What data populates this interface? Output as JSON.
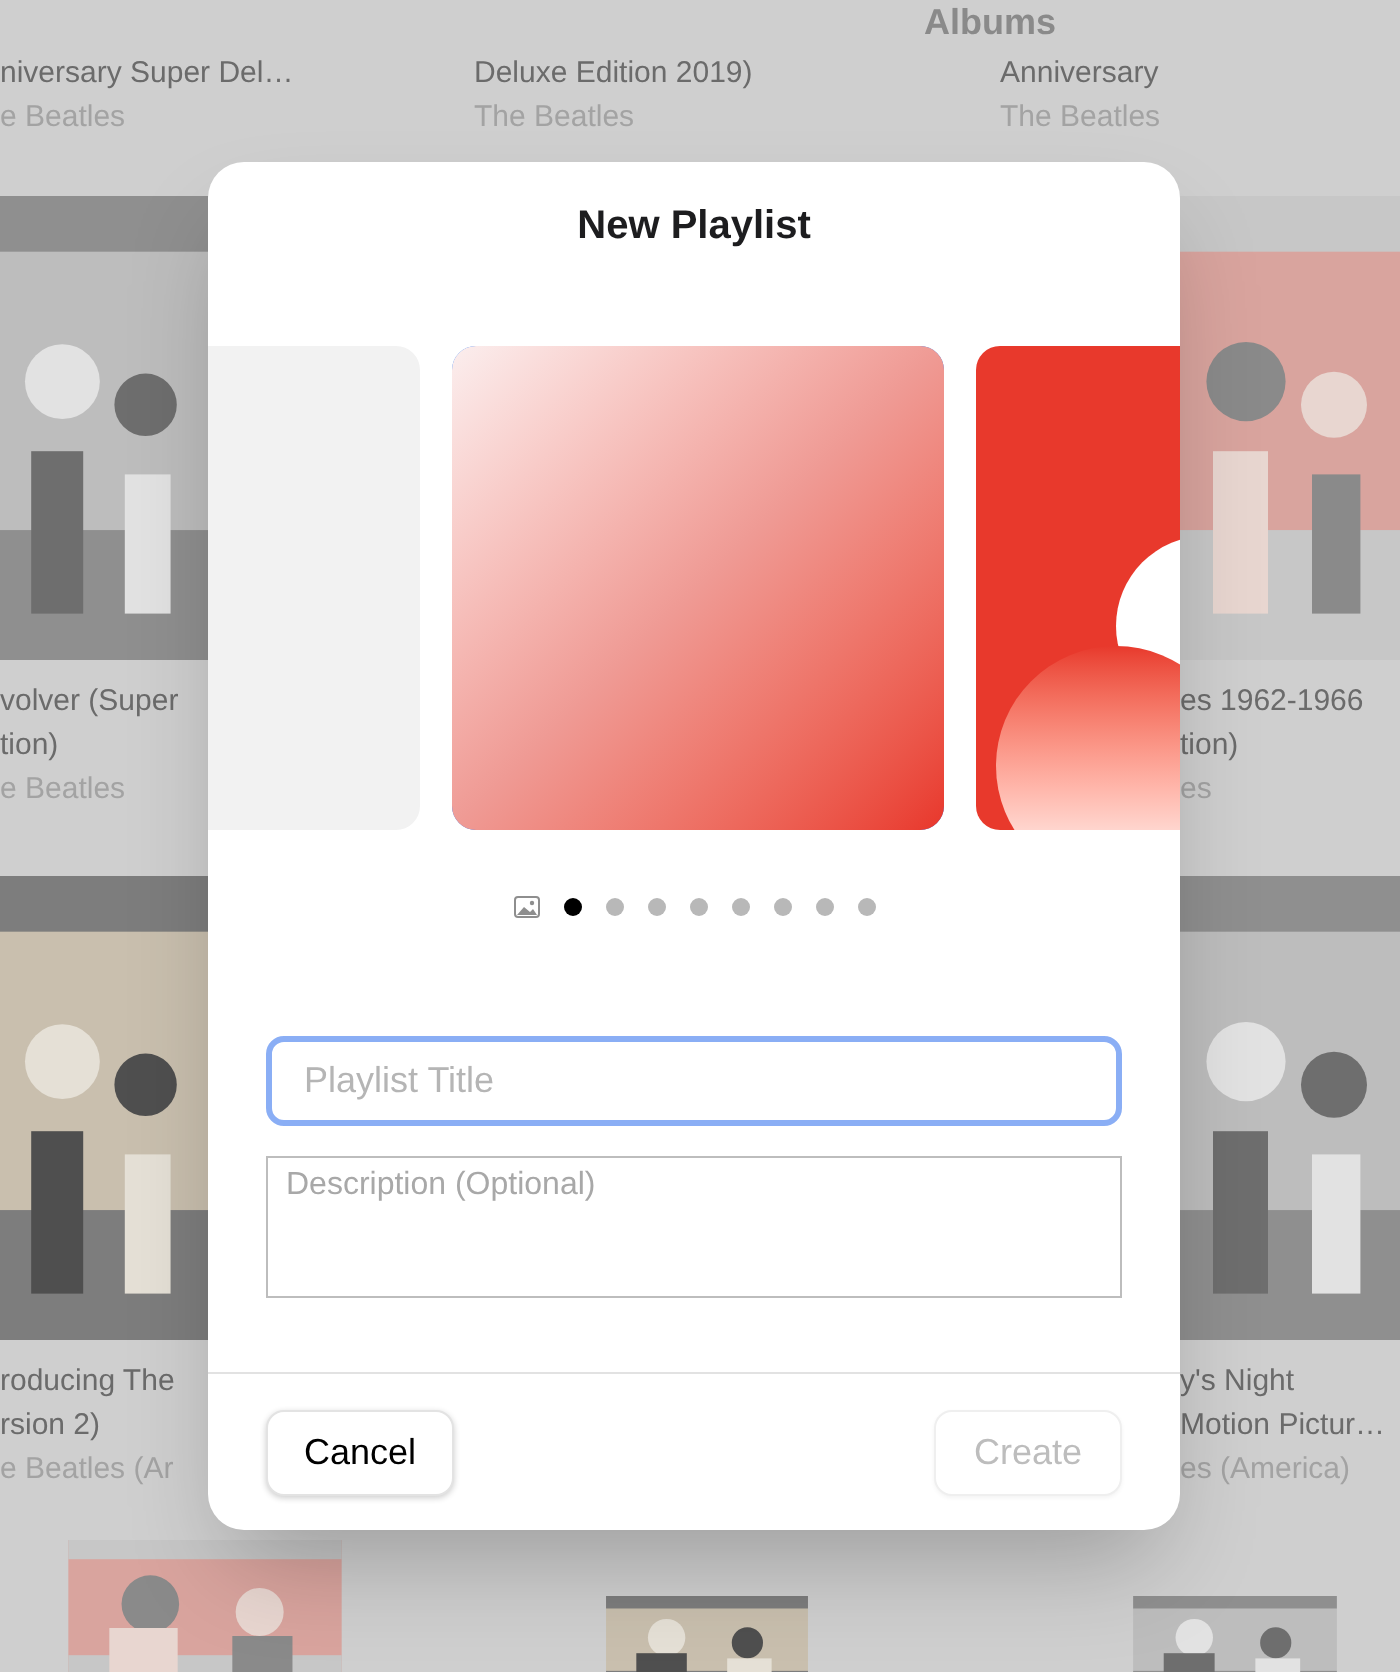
{
  "library": {
    "heading": "Albums",
    "rows": [
      {
        "left": {
          "kind": "album",
          "title": [
            "niversary Super Del…"
          ],
          "artist": "e Beatles"
        },
        "middle": {
          "kind": "album",
          "title": [
            "Deluxe Edition 2019)"
          ],
          "artist": "The Beatles"
        },
        "right": {
          "kind": "album",
          "title": [
            "Anniversary"
          ],
          "artist": "The Beatles"
        }
      },
      {
        "left": {
          "kind": "album",
          "title": [
            "volver (Super",
            "tion)"
          ],
          "artist": "e Beatles"
        },
        "right": {
          "kind": "album",
          "title": [
            "es 1962-1966",
            "tion)"
          ],
          "artist": "es"
        }
      },
      {
        "left": {
          "kind": "album",
          "title": [
            "roducing The",
            "rsion 2)"
          ],
          "artist": "e Beatles (Ar"
        },
        "right": {
          "kind": "album",
          "title": [
            "y's Night",
            "Motion Pictur…"
          ],
          "artist": "es (America)"
        }
      },
      {
        "left": {
          "kind": "picture"
        },
        "middle": {
          "kind": "picture"
        },
        "right": {
          "kind": "picture"
        }
      }
    ]
  },
  "dialog": {
    "title": "New Playlist",
    "artworks": [
      {
        "kind": "plain",
        "selected": false
      },
      {
        "kind": "gradient",
        "selected": true
      },
      {
        "kind": "swirl",
        "selected": false
      }
    ],
    "pages": [
      {
        "selected": true
      },
      {
        "selected": false
      },
      {
        "selected": false
      },
      {
        "selected": false
      },
      {
        "selected": false
      },
      {
        "selected": false
      },
      {
        "selected": false
      },
      {
        "selected": false
      }
    ],
    "title_field": {
      "placeholder": "Playlist Title",
      "focused": true
    },
    "description_field": {
      "placeholder": "Description (Optional)"
    },
    "buttons": [
      {
        "label": "Cancel",
        "disabled": false
      },
      {
        "label": "Create",
        "disabled": true
      }
    ]
  }
}
